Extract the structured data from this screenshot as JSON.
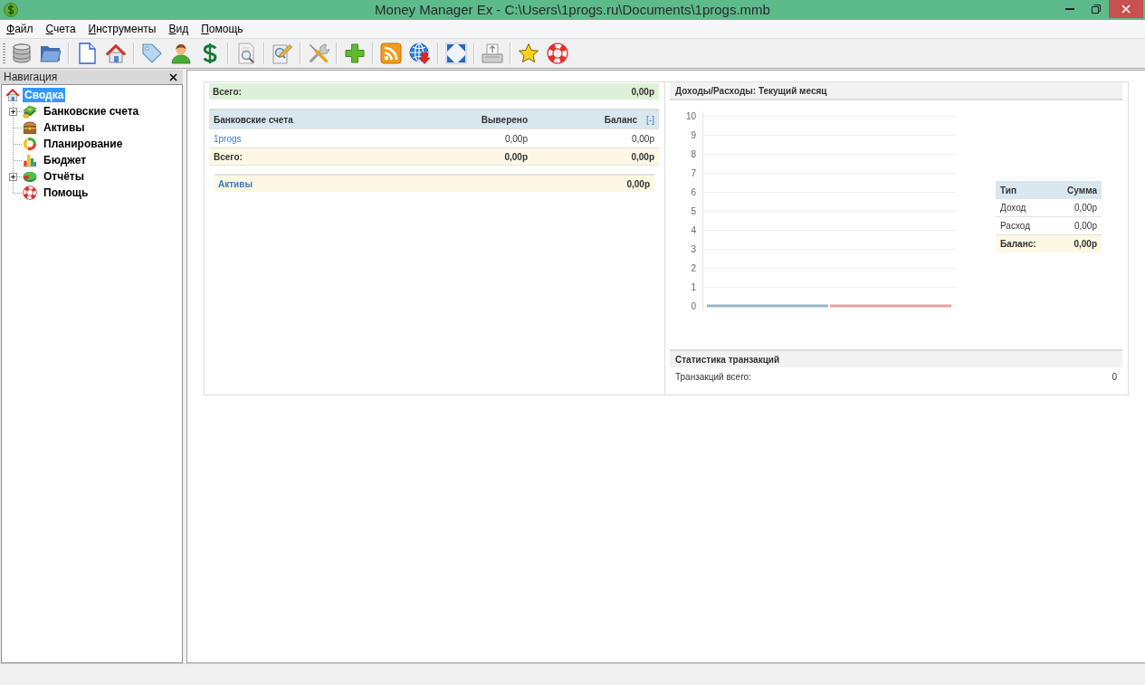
{
  "window": {
    "title": "Money Manager Ex - C:\\Users\\1progs.ru\\Documents\\1progs.mmb"
  },
  "menu": [
    {
      "label": "Файл"
    },
    {
      "label": "Счета"
    },
    {
      "label": "Инструменты"
    },
    {
      "label": "Вид"
    },
    {
      "label": "Помощь"
    }
  ],
  "navigation": {
    "title": "Навигация",
    "tree": [
      {
        "label": "Сводка",
        "selected": true,
        "children": [
          {
            "label": "Банковские счета",
            "selected": false,
            "expandable": true,
            "expanded": false
          },
          {
            "label": "Активы",
            "selected": false,
            "expandable": false
          },
          {
            "label": "Планирование",
            "selected": false,
            "expandable": false
          },
          {
            "label": "Бюджет",
            "selected": false,
            "expandable": false
          },
          {
            "label": "Отчёты",
            "selected": false,
            "expandable": true,
            "expanded": false
          },
          {
            "label": "Помощь",
            "selected": false,
            "expandable": false
          }
        ]
      }
    ]
  },
  "summary": {
    "total": {
      "label": "Всего:",
      "value": "0,00р"
    },
    "accounts": {
      "columns": [
        "Банковские счета",
        "Выверено",
        "Баланс"
      ],
      "toggle": "[-]",
      "rows": [
        {
          "name": "1progs",
          "reconciled": "0,00р",
          "balance": "0,00р"
        }
      ],
      "total": {
        "label": "Всего:",
        "reconciled": "0,00р",
        "balance": "0,00р"
      }
    },
    "assets": {
      "label": "Активы",
      "value": "0,00р"
    }
  },
  "income_expense": {
    "title": "Доходы/Расходы: Текущий месяц",
    "chart_data": {
      "type": "bar",
      "series": [
        {
          "color": "#93b6c4",
          "values": [
            0
          ]
        },
        {
          "color": "#e6a1a4",
          "values": [
            0
          ]
        }
      ],
      "ylim": [
        0,
        10
      ],
      "yticks": [
        0,
        1,
        2,
        3,
        4,
        5,
        6,
        7,
        8,
        9,
        10
      ],
      "grid": true
    },
    "table": {
      "columns": [
        "Тип",
        "Сумма"
      ],
      "rows": [
        {
          "type": "Доход",
          "amount": "0,00р"
        },
        {
          "type": "Расход",
          "amount": "0,00р"
        }
      ],
      "total": {
        "label": "Баланс:",
        "amount": "0,00р"
      }
    }
  },
  "transaction_stats": {
    "title": "Статистика транзакций",
    "rows": [
      {
        "label": "Транзакций всего:",
        "value": "0"
      }
    ]
  }
}
